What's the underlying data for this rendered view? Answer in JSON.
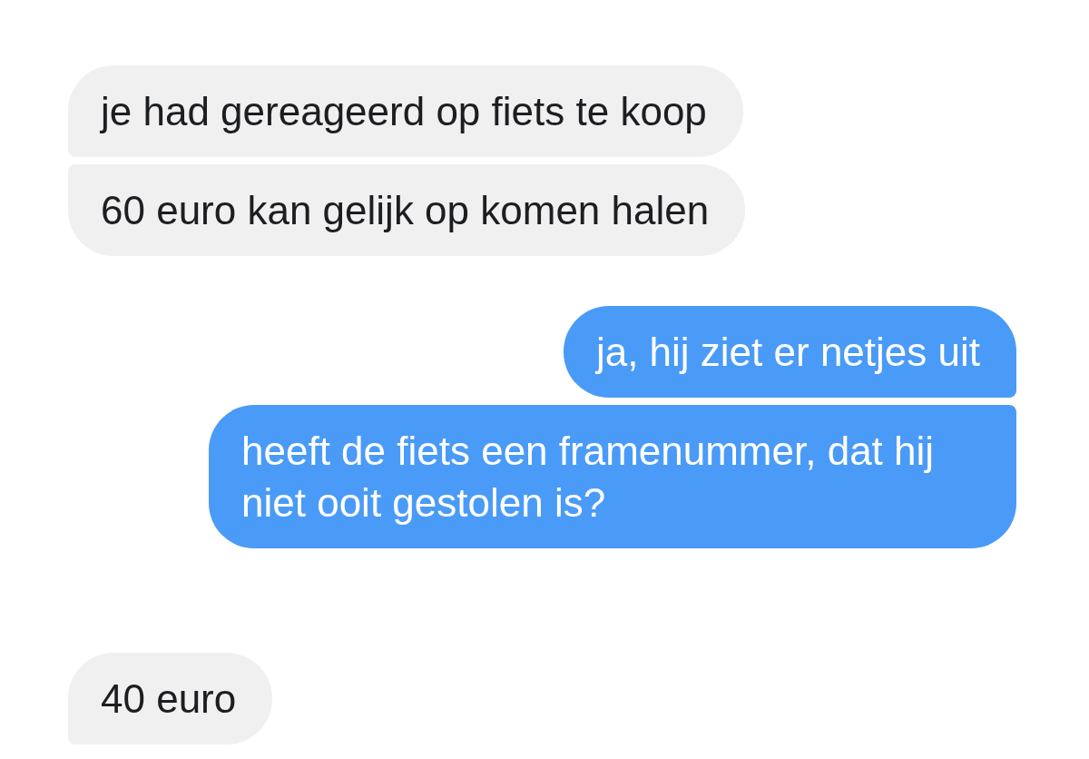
{
  "groups": [
    {
      "kind": "received",
      "messages": [
        {
          "text": "je had gereageerd op fiets te koop",
          "kind": "first"
        },
        {
          "text": "60 euro kan gelijk op komen halen",
          "kind": "last"
        }
      ]
    },
    {
      "kind": "sent",
      "messages": [
        {
          "text": "ja, hij ziet er netjes uit",
          "kind": "first"
        },
        {
          "text": "heeft de fiets een framenummer, dat hij niet ooit gestolen is?",
          "kind": "last"
        }
      ]
    },
    {
      "kind": "received",
      "messages": [
        {
          "text": "40 euro",
          "kind": "first"
        }
      ]
    }
  ]
}
